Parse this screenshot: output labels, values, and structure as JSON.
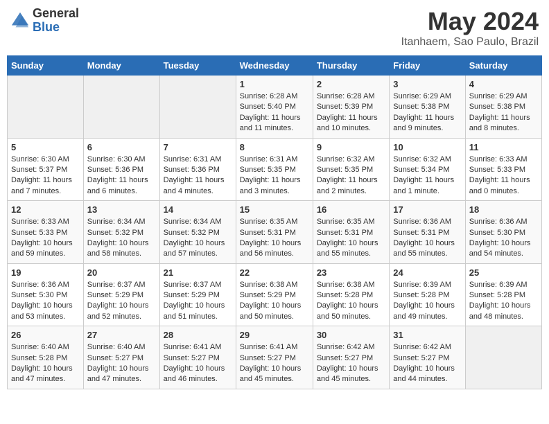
{
  "logo": {
    "general": "General",
    "blue": "Blue"
  },
  "title": "May 2024",
  "subtitle": "Itanhaem, Sao Paulo, Brazil",
  "days_of_week": [
    "Sunday",
    "Monday",
    "Tuesday",
    "Wednesday",
    "Thursday",
    "Friday",
    "Saturday"
  ],
  "weeks": [
    [
      {
        "num": "",
        "info": ""
      },
      {
        "num": "",
        "info": ""
      },
      {
        "num": "",
        "info": ""
      },
      {
        "num": "1",
        "info": "Sunrise: 6:28 AM\nSunset: 5:40 PM\nDaylight: 11 hours and 11 minutes."
      },
      {
        "num": "2",
        "info": "Sunrise: 6:28 AM\nSunset: 5:39 PM\nDaylight: 11 hours and 10 minutes."
      },
      {
        "num": "3",
        "info": "Sunrise: 6:29 AM\nSunset: 5:38 PM\nDaylight: 11 hours and 9 minutes."
      },
      {
        "num": "4",
        "info": "Sunrise: 6:29 AM\nSunset: 5:38 PM\nDaylight: 11 hours and 8 minutes."
      }
    ],
    [
      {
        "num": "5",
        "info": "Sunrise: 6:30 AM\nSunset: 5:37 PM\nDaylight: 11 hours and 7 minutes."
      },
      {
        "num": "6",
        "info": "Sunrise: 6:30 AM\nSunset: 5:36 PM\nDaylight: 11 hours and 6 minutes."
      },
      {
        "num": "7",
        "info": "Sunrise: 6:31 AM\nSunset: 5:36 PM\nDaylight: 11 hours and 4 minutes."
      },
      {
        "num": "8",
        "info": "Sunrise: 6:31 AM\nSunset: 5:35 PM\nDaylight: 11 hours and 3 minutes."
      },
      {
        "num": "9",
        "info": "Sunrise: 6:32 AM\nSunset: 5:35 PM\nDaylight: 11 hours and 2 minutes."
      },
      {
        "num": "10",
        "info": "Sunrise: 6:32 AM\nSunset: 5:34 PM\nDaylight: 11 hours and 1 minute."
      },
      {
        "num": "11",
        "info": "Sunrise: 6:33 AM\nSunset: 5:33 PM\nDaylight: 11 hours and 0 minutes."
      }
    ],
    [
      {
        "num": "12",
        "info": "Sunrise: 6:33 AM\nSunset: 5:33 PM\nDaylight: 10 hours and 59 minutes."
      },
      {
        "num": "13",
        "info": "Sunrise: 6:34 AM\nSunset: 5:32 PM\nDaylight: 10 hours and 58 minutes."
      },
      {
        "num": "14",
        "info": "Sunrise: 6:34 AM\nSunset: 5:32 PM\nDaylight: 10 hours and 57 minutes."
      },
      {
        "num": "15",
        "info": "Sunrise: 6:35 AM\nSunset: 5:31 PM\nDaylight: 10 hours and 56 minutes."
      },
      {
        "num": "16",
        "info": "Sunrise: 6:35 AM\nSunset: 5:31 PM\nDaylight: 10 hours and 55 minutes."
      },
      {
        "num": "17",
        "info": "Sunrise: 6:36 AM\nSunset: 5:31 PM\nDaylight: 10 hours and 55 minutes."
      },
      {
        "num": "18",
        "info": "Sunrise: 6:36 AM\nSunset: 5:30 PM\nDaylight: 10 hours and 54 minutes."
      }
    ],
    [
      {
        "num": "19",
        "info": "Sunrise: 6:36 AM\nSunset: 5:30 PM\nDaylight: 10 hours and 53 minutes."
      },
      {
        "num": "20",
        "info": "Sunrise: 6:37 AM\nSunset: 5:29 PM\nDaylight: 10 hours and 52 minutes."
      },
      {
        "num": "21",
        "info": "Sunrise: 6:37 AM\nSunset: 5:29 PM\nDaylight: 10 hours and 51 minutes."
      },
      {
        "num": "22",
        "info": "Sunrise: 6:38 AM\nSunset: 5:29 PM\nDaylight: 10 hours and 50 minutes."
      },
      {
        "num": "23",
        "info": "Sunrise: 6:38 AM\nSunset: 5:28 PM\nDaylight: 10 hours and 50 minutes."
      },
      {
        "num": "24",
        "info": "Sunrise: 6:39 AM\nSunset: 5:28 PM\nDaylight: 10 hours and 49 minutes."
      },
      {
        "num": "25",
        "info": "Sunrise: 6:39 AM\nSunset: 5:28 PM\nDaylight: 10 hours and 48 minutes."
      }
    ],
    [
      {
        "num": "26",
        "info": "Sunrise: 6:40 AM\nSunset: 5:28 PM\nDaylight: 10 hours and 47 minutes."
      },
      {
        "num": "27",
        "info": "Sunrise: 6:40 AM\nSunset: 5:27 PM\nDaylight: 10 hours and 47 minutes."
      },
      {
        "num": "28",
        "info": "Sunrise: 6:41 AM\nSunset: 5:27 PM\nDaylight: 10 hours and 46 minutes."
      },
      {
        "num": "29",
        "info": "Sunrise: 6:41 AM\nSunset: 5:27 PM\nDaylight: 10 hours and 45 minutes."
      },
      {
        "num": "30",
        "info": "Sunrise: 6:42 AM\nSunset: 5:27 PM\nDaylight: 10 hours and 45 minutes."
      },
      {
        "num": "31",
        "info": "Sunrise: 6:42 AM\nSunset: 5:27 PM\nDaylight: 10 hours and 44 minutes."
      },
      {
        "num": "",
        "info": ""
      }
    ]
  ]
}
